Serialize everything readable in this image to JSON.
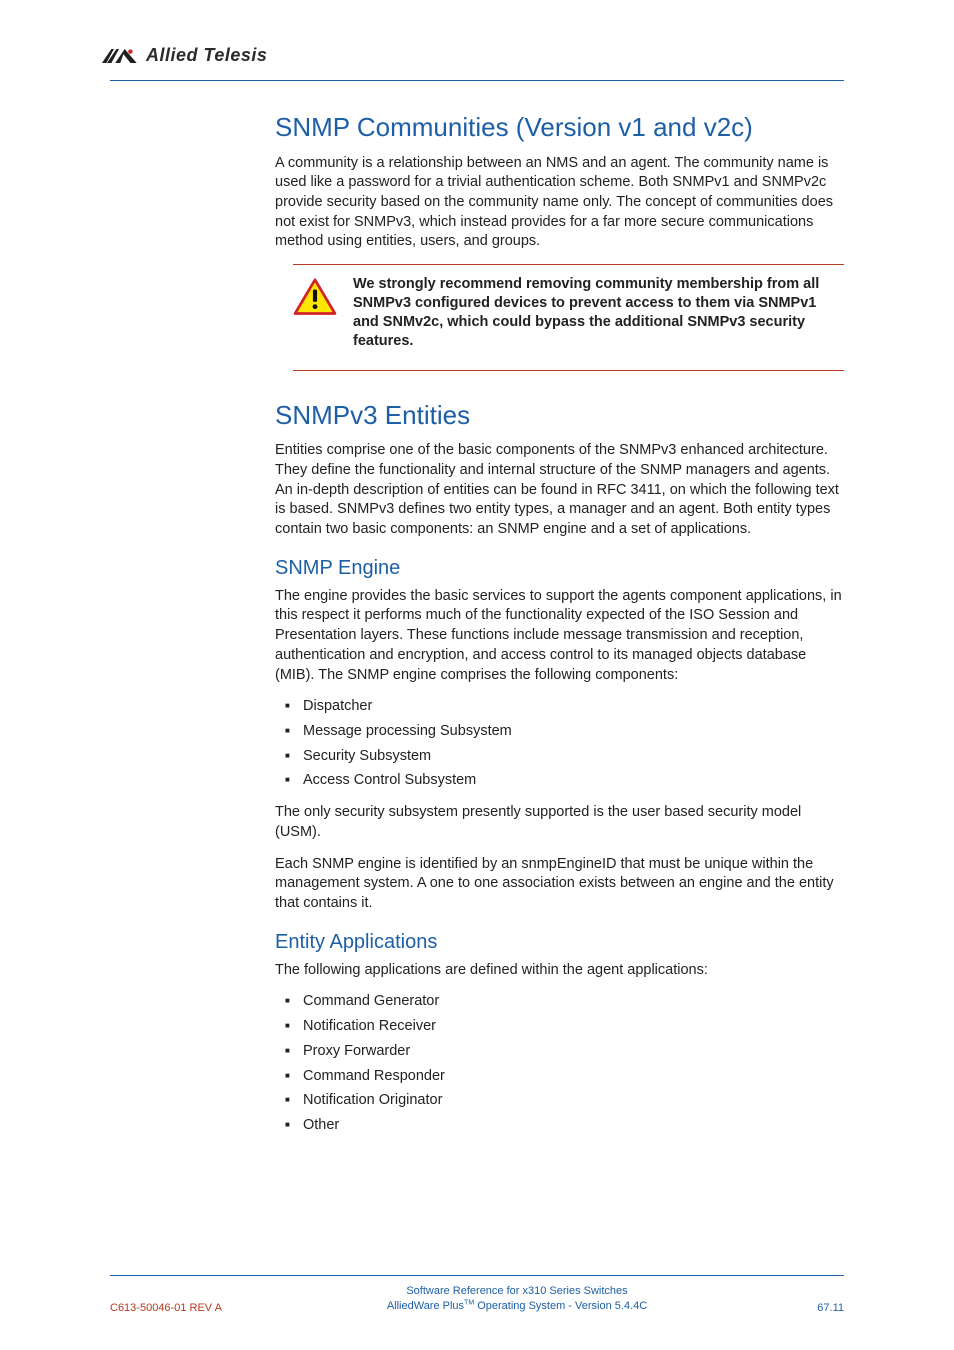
{
  "brand": {
    "name": "Allied Telesis"
  },
  "sections": {
    "snmp_communities": {
      "heading": "SNMP Communities (Version v1 and v2c)",
      "paragraph": "A community is a relationship between an NMS and an agent. The community name is used like a password for a trivial authentication scheme. Both SNMPv1 and SNMPv2c provide security based on the community name only. The concept of communities does not exist for SNMPv3, which instead provides for a far more secure communications method using entities, users, and groups.",
      "callout": "We strongly recommend removing community membership from all SNMPv3 configured devices to prevent access to them via SNMPv1 and SNMv2c, which could bypass the additional SNMPv3 security features."
    },
    "snmpv3_entities": {
      "heading": "SNMPv3 Entities",
      "paragraph": "Entities comprise one of the basic components of the SNMPv3 enhanced architecture. They define the functionality and internal structure of the SNMP managers and agents. An in-depth description of entities can be found in RFC 3411, on which the following text is based. SNMPv3 defines two entity types, a manager and an agent. Both entity types contain two basic components: an SNMP engine and a set of applications."
    },
    "snmp_engine": {
      "heading": "SNMP Engine",
      "paragraph": "The engine provides the basic services to support the agents component applications, in this respect it performs much of the functionality expected of the ISO Session and Presentation layers. These functions include message transmission and reception, authentication and encryption, and access control to its managed objects database (MIB). The SNMP engine comprises the following components:",
      "items": {
        "0": "Dispatcher",
        "1": "Message processing Subsystem",
        "2": "Security Subsystem",
        "3": "Access Control Subsystem"
      },
      "after_list_1": "The only security subsystem presently supported is the user based security model (USM).",
      "after_list_2": "Each SNMP engine is identified by an snmpEngineID that must be unique within the management system. A one to one association exists between an engine and the entity that contains it."
    },
    "entity_applications": {
      "heading": "Entity Applications",
      "paragraph": "The following applications are defined within the agent applications:",
      "items": {
        "0": "Command Generator",
        "1": "Notification Receiver",
        "2": "Proxy Forwarder",
        "3": "Command Responder",
        "4": "Notification Originator",
        "5": "Other"
      }
    }
  },
  "footer": {
    "rev": "C613-50046-01 REV A",
    "line1": "Software Reference for x310 Series Switches",
    "line2_prefix": "AlliedWare Plus",
    "line2_tm": "TM",
    "line2_suffix": " Operating System - Version 5.4.4C",
    "page": "67.11"
  }
}
